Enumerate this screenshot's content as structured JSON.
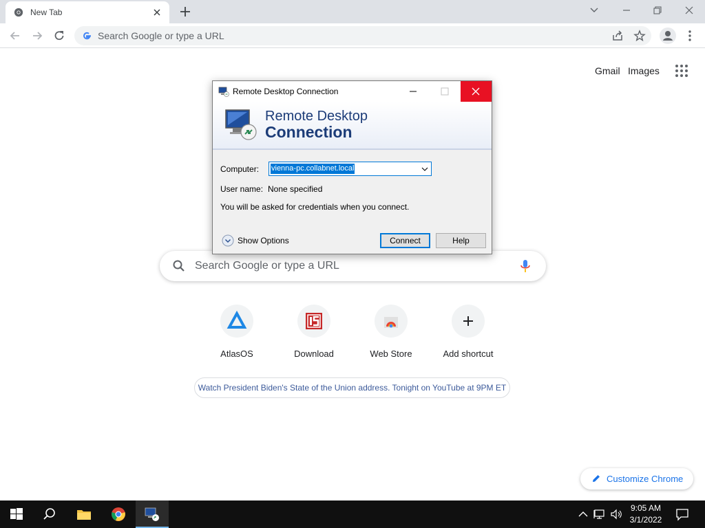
{
  "browser": {
    "tab_title": "New Tab",
    "omnibox_placeholder": "Search Google or type a URL"
  },
  "ntp": {
    "top_links": [
      "Gmail",
      "Images"
    ],
    "search_placeholder": "Search Google or type a URL",
    "shortcuts": [
      {
        "label": "AtlasOS",
        "icon": "atlasos-icon"
      },
      {
        "label": "Download",
        "icon": "download-site-icon"
      },
      {
        "label": "Web Store",
        "icon": "web-store-icon"
      },
      {
        "label": "Add shortcut",
        "icon": "plus-icon"
      }
    ],
    "promo_text": "Watch President Biden's State of the Union address. Tonight on YouTube at 9PM ET",
    "customize_label": "Customize Chrome"
  },
  "rdp": {
    "window_title": "Remote Desktop Connection",
    "banner_line1": "Remote Desktop",
    "banner_line2": "Connection",
    "computer_label": "Computer:",
    "computer_value": "vienna-pc.collabnet.local",
    "username_label": "User name:",
    "username_value": "None specified",
    "info_text": "You will be asked for credentials when you connect.",
    "show_options": "Show Options",
    "connect_label": "Connect",
    "help_label": "Help"
  },
  "taskbar": {
    "time": "9:05 AM",
    "date": "3/1/2022"
  },
  "colors": {
    "accent_blue": "#1a73e8",
    "close_red": "#e81123",
    "selection_blue": "#0078d7",
    "taskbar_bg": "#101010"
  }
}
